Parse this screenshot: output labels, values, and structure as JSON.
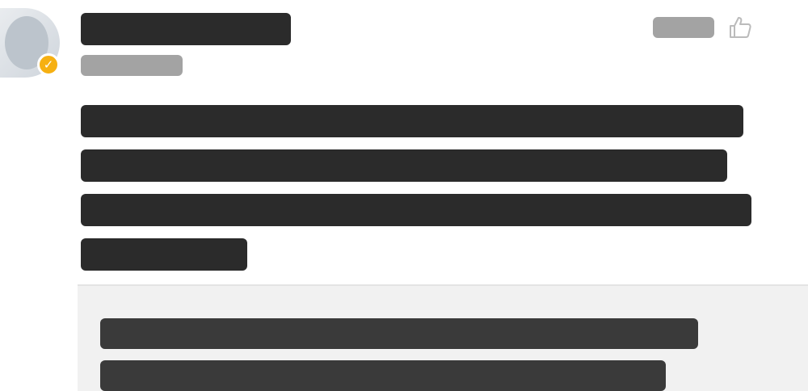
{
  "post": {
    "author_line_count": 1,
    "message_line_count": 4,
    "reply_line_count": 2
  }
}
